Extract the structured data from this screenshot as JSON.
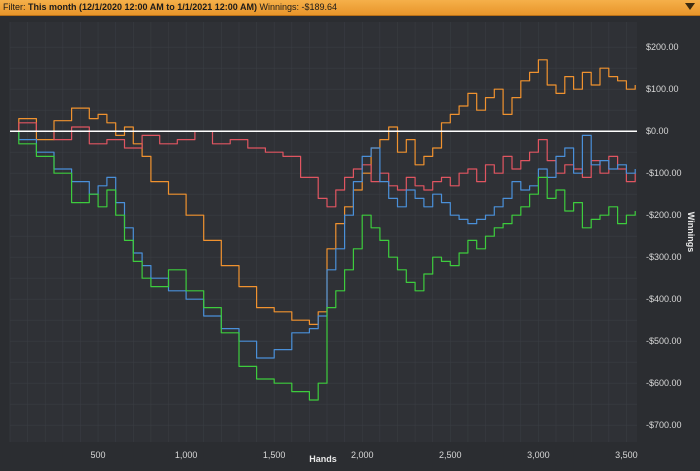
{
  "filter": {
    "label": "Filter:",
    "range": "This month (12/1/2020 12:00 AM to 1/1/2021 12:00 AM)",
    "winnings_label": "Winnings:",
    "winnings_value": "-$189.64"
  },
  "chart_data": {
    "type": "line",
    "title": "",
    "xlabel": "Hands",
    "ylabel": "Winnings",
    "xlim": [
      0,
      3560
    ],
    "ylim": [
      -740,
      260
    ],
    "x_ticks": [
      500,
      1000,
      1500,
      2000,
      2500,
      3000,
      3500
    ],
    "x_tick_labels": [
      "500",
      "1,000",
      "1,500",
      "2,000",
      "2,500",
      "3,000",
      "3,500"
    ],
    "y_ticks": [
      200,
      100,
      0,
      -100,
      -200,
      -300,
      -400,
      -500,
      -600,
      -700
    ],
    "y_tick_labels": [
      "$200.00",
      "$100.00",
      "$0.00",
      "-$100.00",
      "-$200.00",
      "-$300.00",
      "-$400.00",
      "-$500.00",
      "-$600.00",
      "-$700.00"
    ],
    "grid": true,
    "zero_line": true,
    "series": [
      {
        "color": "#f0922f",
        "x": [
          0,
          50,
          150,
          250,
          350,
          450,
          500,
          550,
          600,
          650,
          700,
          750,
          800,
          900,
          1000,
          1100,
          1200,
          1300,
          1400,
          1500,
          1600,
          1700,
          1750,
          1800,
          1850,
          1900,
          1950,
          2000,
          2050,
          2100,
          2150,
          2200,
          2250,
          2300,
          2350,
          2400,
          2450,
          2500,
          2550,
          2600,
          2650,
          2700,
          2750,
          2800,
          2850,
          2900,
          2950,
          3000,
          3050,
          3100,
          3150,
          3200,
          3250,
          3300,
          3350,
          3400,
          3450,
          3500,
          3550
        ],
        "y": [
          0,
          30,
          -20,
          25,
          55,
          30,
          40,
          20,
          -10,
          10,
          -30,
          -60,
          -120,
          -150,
          -200,
          -260,
          -320,
          -370,
          -420,
          -430,
          -450,
          -460,
          -430,
          -280,
          -220,
          -180,
          -140,
          -100,
          -40,
          -20,
          10,
          -50,
          -20,
          -80,
          -60,
          -40,
          20,
          40,
          60,
          90,
          50,
          80,
          100,
          40,
          80,
          120,
          140,
          170,
          110,
          90,
          130,
          100,
          140,
          110,
          150,
          130,
          120,
          100,
          110
        ]
      },
      {
        "color": "#e05561",
        "x": [
          0,
          50,
          150,
          250,
          350,
          450,
          550,
          650,
          750,
          850,
          950,
          1050,
          1150,
          1250,
          1350,
          1450,
          1550,
          1650,
          1750,
          1800,
          1850,
          1900,
          1950,
          2000,
          2050,
          2100,
          2150,
          2200,
          2250,
          2300,
          2350,
          2400,
          2450,
          2500,
          2550,
          2600,
          2650,
          2700,
          2750,
          2800,
          2850,
          2900,
          2950,
          3000,
          3050,
          3100,
          3150,
          3200,
          3250,
          3300,
          3350,
          3400,
          3450,
          3500,
          3550
        ],
        "y": [
          0,
          20,
          0,
          -20,
          10,
          -30,
          -20,
          -40,
          -10,
          -30,
          -20,
          0,
          -30,
          -20,
          -40,
          -50,
          -60,
          -110,
          -160,
          -180,
          -140,
          -110,
          -90,
          -80,
          -120,
          -100,
          -130,
          -140,
          -110,
          -130,
          -140,
          -120,
          -110,
          -130,
          -100,
          -90,
          -120,
          -80,
          -100,
          -60,
          -90,
          -70,
          -50,
          -20,
          -70,
          -100,
          -80,
          -90,
          -110,
          -70,
          -100,
          -60,
          -90,
          -120,
          -100
        ]
      },
      {
        "color": "#4a90d9",
        "x": [
          0,
          50,
          150,
          250,
          350,
          450,
          500,
          550,
          600,
          650,
          700,
          750,
          800,
          900,
          1000,
          1100,
          1200,
          1300,
          1400,
          1500,
          1600,
          1700,
          1750,
          1800,
          1850,
          1900,
          1950,
          2000,
          2050,
          2100,
          2150,
          2200,
          2250,
          2300,
          2350,
          2400,
          2450,
          2500,
          2550,
          2600,
          2650,
          2700,
          2750,
          2800,
          2850,
          2900,
          2950,
          3000,
          3050,
          3100,
          3150,
          3200,
          3250,
          3300,
          3350,
          3400,
          3450,
          3500,
          3550
        ],
        "y": [
          0,
          -20,
          -50,
          -90,
          -120,
          -150,
          -130,
          -110,
          -170,
          -230,
          -290,
          -320,
          -350,
          -380,
          -400,
          -440,
          -470,
          -500,
          -540,
          -520,
          -480,
          -470,
          -440,
          -330,
          -280,
          -200,
          -120,
          -60,
          -40,
          -120,
          -160,
          -180,
          -140,
          -160,
          -180,
          -150,
          -170,
          -200,
          -210,
          -220,
          -210,
          -200,
          -180,
          -160,
          -120,
          -140,
          -130,
          -90,
          -110,
          -60,
          -40,
          -100,
          -10,
          -80,
          -70,
          -90,
          -80,
          -100,
          -90
        ]
      },
      {
        "color": "#3dcc3d",
        "x": [
          0,
          50,
          150,
          250,
          350,
          450,
          500,
          550,
          600,
          650,
          700,
          750,
          800,
          900,
          1000,
          1100,
          1200,
          1300,
          1400,
          1500,
          1600,
          1700,
          1750,
          1800,
          1850,
          1900,
          1950,
          2000,
          2050,
          2100,
          2150,
          2200,
          2250,
          2300,
          2350,
          2400,
          2450,
          2500,
          2550,
          2600,
          2650,
          2700,
          2750,
          2800,
          2850,
          2900,
          2950,
          3000,
          3050,
          3100,
          3150,
          3200,
          3250,
          3300,
          3350,
          3400,
          3450,
          3500,
          3550
        ],
        "y": [
          0,
          -30,
          -60,
          -100,
          -170,
          -150,
          -180,
          -140,
          -200,
          -260,
          -310,
          -350,
          -370,
          -330,
          -380,
          -420,
          -480,
          -560,
          -590,
          -600,
          -620,
          -640,
          -600,
          -420,
          -380,
          -330,
          -280,
          -200,
          -230,
          -260,
          -300,
          -330,
          -360,
          -380,
          -340,
          -300,
          -310,
          -320,
          -290,
          -260,
          -280,
          -250,
          -230,
          -220,
          -200,
          -180,
          -150,
          -110,
          -160,
          -140,
          -190,
          -170,
          -230,
          -210,
          -200,
          -180,
          -220,
          -200,
          -190
        ]
      }
    ]
  }
}
